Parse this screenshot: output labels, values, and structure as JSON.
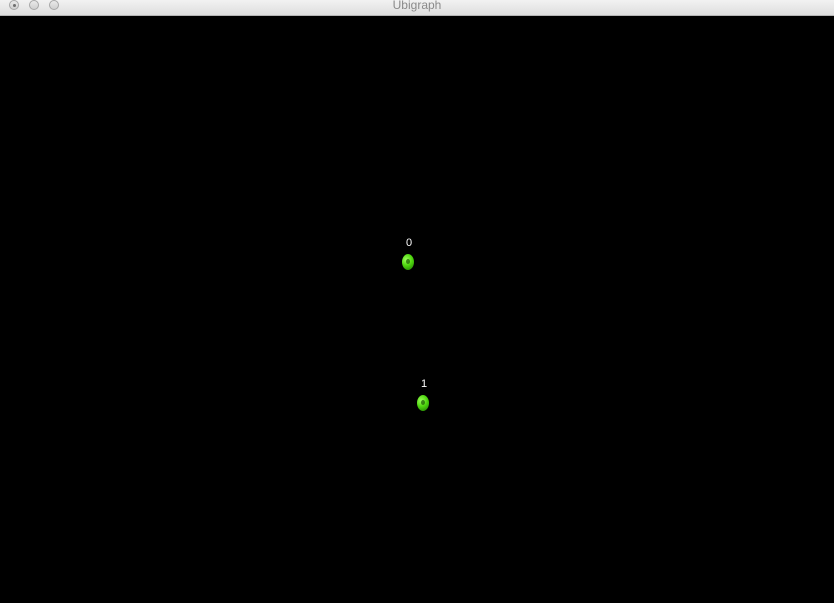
{
  "window": {
    "title": "Ubigraph"
  },
  "graph": {
    "background_color": "#000000",
    "vertex_color": "#4fd60f",
    "label_color": "#ffffff",
    "vertices": [
      {
        "id": "0",
        "label": "0"
      },
      {
        "id": "1",
        "label": "1"
      }
    ]
  }
}
